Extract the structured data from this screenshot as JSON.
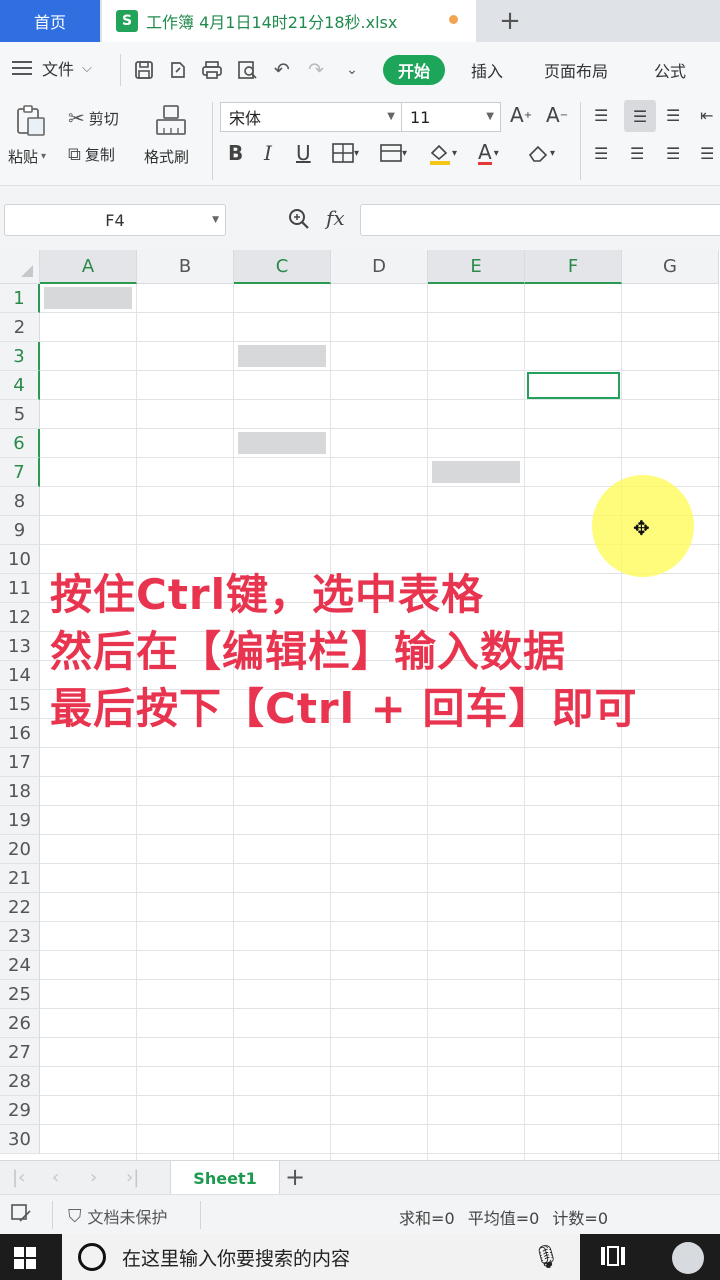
{
  "tabs": {
    "home": "首页",
    "document": "工作簿 4月1日14时21分18秒.xlsx",
    "new_tab": "+"
  },
  "menu": {
    "file": "文件",
    "ribbon_tabs": [
      "开始",
      "插入",
      "页面布局",
      "公式"
    ],
    "active_tab_color": "#1da65a"
  },
  "ribbon": {
    "paste": "粘贴",
    "cut": "剪切",
    "copy": "复制",
    "format_painter": "格式刷",
    "font_name": "宋体",
    "font_size": "11"
  },
  "formula_bar": {
    "name_box": "F4",
    "fx": "fx",
    "formula": ""
  },
  "grid": {
    "columns": [
      "A",
      "B",
      "C",
      "D",
      "E",
      "F",
      "G"
    ],
    "selected_columns": [
      "A",
      "C",
      "E",
      "F"
    ],
    "rows": [
      "1",
      "2",
      "3",
      "4",
      "5",
      "6",
      "7",
      "8",
      "9",
      "10",
      "11",
      "12",
      "13",
      "14",
      "15",
      "16",
      "17",
      "18",
      "19",
      "20",
      "21",
      "22",
      "23",
      "24",
      "25",
      "26",
      "27",
      "28",
      "29",
      "30"
    ],
    "selected_rows": [
      "1",
      "3",
      "4",
      "6",
      "7"
    ],
    "selected_cells": [
      "A1",
      "C3",
      "C6",
      "E7"
    ],
    "active_cell": "F4",
    "accent_color": "#23a05a"
  },
  "overlay": {
    "lines": [
      "按住Ctrl键，选中表格",
      "然后在【编辑栏】输入数据",
      "最后按下【Ctrl + 回车】即可"
    ],
    "color": "#e8344f"
  },
  "sheets": {
    "tabs": [
      "Sheet1"
    ],
    "add": "+"
  },
  "status": {
    "protection": "文档未保护",
    "sum": "求和=0",
    "average": "平均值=0",
    "count": "计数=0"
  },
  "taskbar": {
    "search_placeholder": "在这里输入你要搜索的内容"
  }
}
